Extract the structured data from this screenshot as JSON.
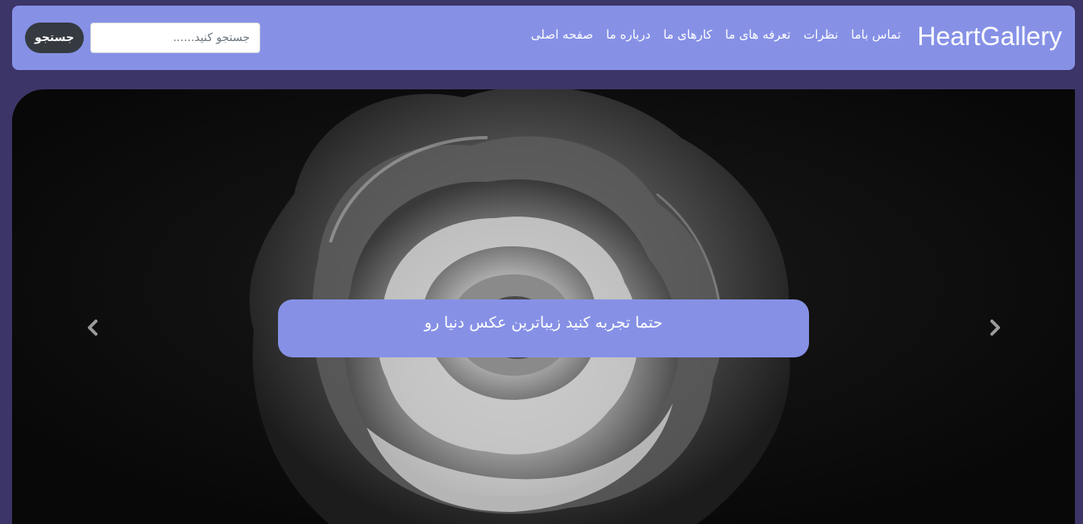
{
  "navbar": {
    "brand": "HeartGallery",
    "links": [
      {
        "label": "صفحه اصلی"
      },
      {
        "label": "درباره ما"
      },
      {
        "label": "کارهای ما"
      },
      {
        "label": "تعرفه های ما"
      },
      {
        "label": "نظرات"
      },
      {
        "label": "تماس باما"
      }
    ],
    "search": {
      "placeholder": "جستجو کنید......",
      "value": "",
      "button_label": "جستجو"
    }
  },
  "carousel": {
    "caption": "حتما تجربه کنید زیباترین عکس دنیا رو",
    "prev_icon": "chevron-left-icon",
    "next_icon": "chevron-right-icon"
  },
  "colors": {
    "page_background": "#3c3567",
    "accent": "#8691e6",
    "button_dark": "#343a40"
  }
}
